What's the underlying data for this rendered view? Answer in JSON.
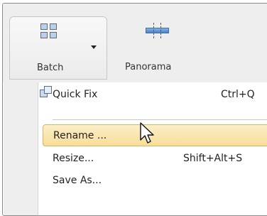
{
  "ribbon": {
    "batch_label": "Batch",
    "panorama_label": "Panorama"
  },
  "menu": {
    "items": [
      {
        "label": "Quick Fix",
        "shortcut": "Ctrl+Q"
      },
      {
        "label": "Rename ...",
        "shortcut": ""
      },
      {
        "label": "Resize...",
        "shortcut": "Shift+Alt+S"
      },
      {
        "label": "Save As...",
        "shortcut": ""
      }
    ],
    "highlighted_label": "Rename ...",
    "highlight_color": "#f9e4a8"
  },
  "icons": {
    "batch": "batch-grid-icon",
    "panorama": "panorama-icon",
    "quick_fix": "quick-fix-icon",
    "dropdown": "chevron-down-icon",
    "cursor": "mouse-cursor-icon"
  }
}
